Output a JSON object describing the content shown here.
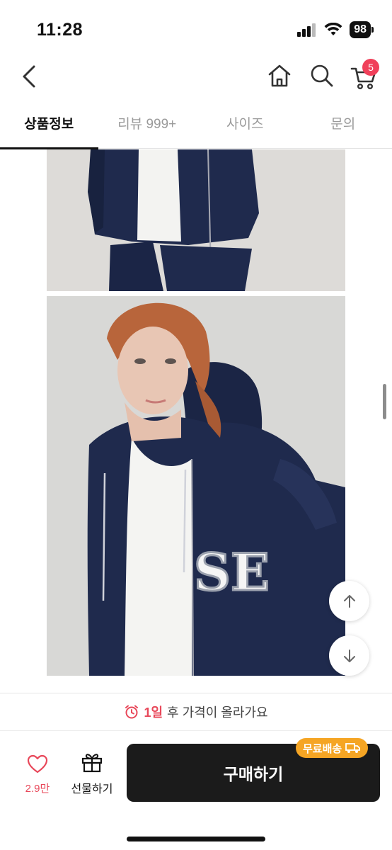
{
  "status_bar": {
    "time": "11:28",
    "battery": "98"
  },
  "header": {
    "cart_count": "5"
  },
  "tabs": [
    {
      "label": "상품정보",
      "active": true
    },
    {
      "label": "리뷰 999+",
      "active": false
    },
    {
      "label": "사이즈",
      "active": false
    },
    {
      "label": "문의",
      "active": false
    }
  ],
  "product_images": {
    "jacket_print": "SE"
  },
  "price_notice": {
    "days": "1일",
    "text": "후 가격이 올라가요"
  },
  "bottom_bar": {
    "like_count": "2.9만",
    "gift_label": "선물하기",
    "buy_label": "구매하기",
    "free_shipping_label": "무료배송"
  },
  "colors": {
    "accent_red": "#e8485a",
    "badge_orange": "#f5a524",
    "buy_button": "#1b1b1b",
    "navy": "#1f2a4d"
  }
}
